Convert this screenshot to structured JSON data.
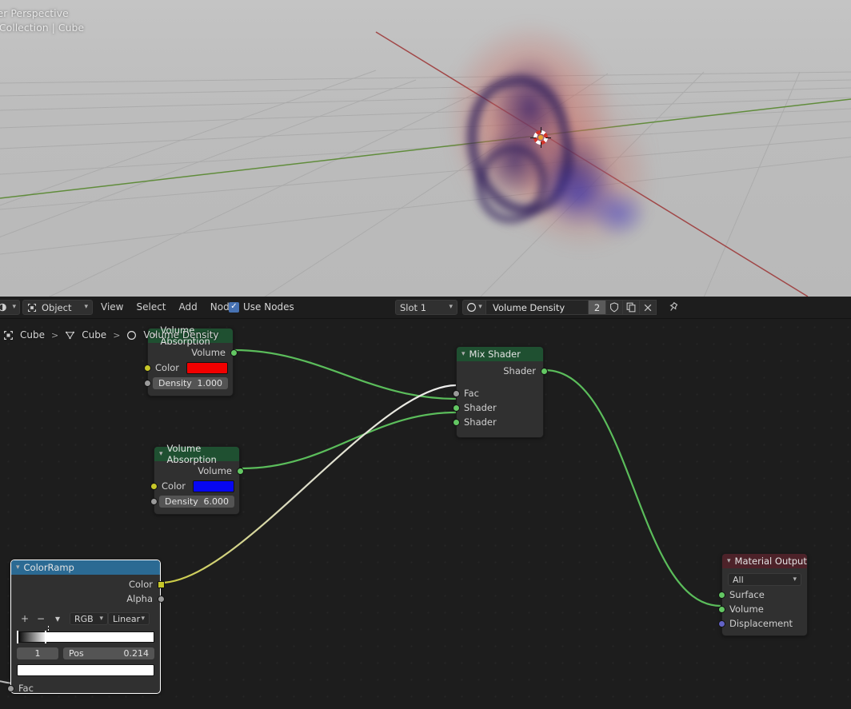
{
  "viewport": {
    "overlay_line1": "ser Perspective",
    "overlay_line2": ") Collection | Cube",
    "cursor_icon": "3d-cursor-icon"
  },
  "header": {
    "editor_type_icon": "node-editor-icon",
    "shading_type": "Object",
    "menus": [
      "View",
      "Select",
      "Add",
      "Node"
    ],
    "use_nodes_label": "Use Nodes",
    "use_nodes_checked": true,
    "slot": "Slot 1",
    "material_icon": "material-sphere-icon",
    "material_name": "Volume Density",
    "material_users": "2",
    "fake_user_icon": "shield-icon",
    "duplicate_icon": "copy-icon",
    "unlink_icon": "x-icon",
    "pin_icon": "pin-icon"
  },
  "breadcrumb": {
    "items": [
      "Cube",
      "Cube",
      "Volume Density"
    ],
    "separator": ">",
    "object_icon": "object-icon",
    "mesh_icon": "mesh-data-icon",
    "material_icon": "material-sphere-icon"
  },
  "nodes": {
    "volume_scatter": {
      "title": "Volume Absorption",
      "outputs": [
        {
          "label": "Volume",
          "socket": "shader"
        }
      ],
      "color_label": "Color",
      "color_value": "#f20000",
      "density_label": "Density",
      "density_value": "1.000"
    },
    "volume_absorption": {
      "title": "Volume Absorption",
      "outputs": [
        {
          "label": "Volume",
          "socket": "shader"
        }
      ],
      "color_label": "Color",
      "color_value": "#0707f2",
      "density_label": "Density",
      "density_value": "6.000"
    },
    "mix_shader": {
      "title": "Mix Shader",
      "outputs": [
        {
          "label": "Shader",
          "socket": "shader"
        }
      ],
      "inputs": [
        {
          "label": "Fac",
          "socket": "grey"
        },
        {
          "label": "Shader",
          "socket": "shader"
        },
        {
          "label": "Shader",
          "socket": "shader"
        }
      ]
    },
    "color_ramp": {
      "title": "ColorRamp",
      "selected": true,
      "outputs": [
        {
          "label": "Color",
          "socket": "yellow"
        },
        {
          "label": "Alpha",
          "socket": "grey"
        }
      ],
      "add_label": "+",
      "remove_label": "−",
      "menu_icon": "chevron-down-icon",
      "color_mode": "RGB",
      "interpolation": "Linear",
      "stops": [
        {
          "position": 0.0,
          "color": "#000000"
        },
        {
          "position": 0.214,
          "color": "#ffffff",
          "active": true
        }
      ],
      "index_value": "1",
      "pos_label": "Pos",
      "pos_value": "0.214",
      "swatch_color": "#ffffff",
      "inputs": [
        {
          "label": "Fac",
          "socket": "grey"
        }
      ]
    },
    "material_output": {
      "title": "Material Output",
      "target": "All",
      "inputs": [
        {
          "label": "Surface",
          "socket": "shader"
        },
        {
          "label": "Volume",
          "socket": "shader"
        },
        {
          "label": "Displacement",
          "socket": "violet"
        }
      ]
    }
  },
  "colors": {
    "link_shader": "#5bbd5b",
    "link_value": "#d8d8c0",
    "header_green": "#1f5031",
    "header_blue": "#2b6a93",
    "header_red": "#4d2229"
  }
}
